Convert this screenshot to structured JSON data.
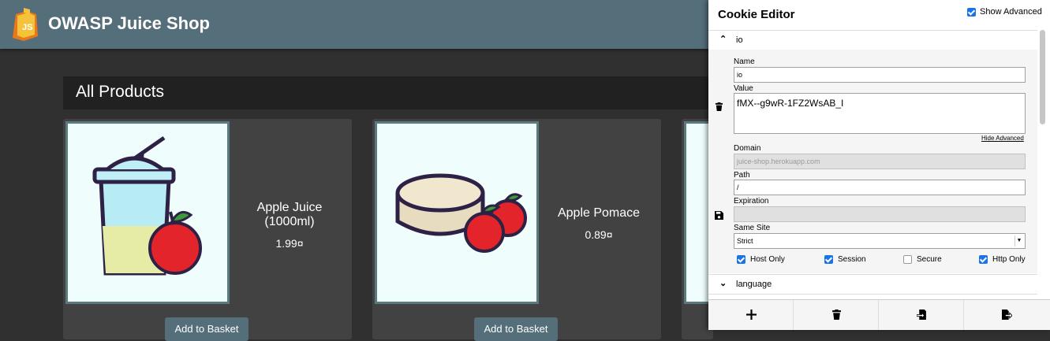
{
  "app": {
    "title": "OWASP Juice Shop"
  },
  "heading": "All Products",
  "products": [
    {
      "name": "Apple Juice (1000ml)",
      "price": "1.99¤",
      "button": "Add to Basket"
    },
    {
      "name": "Apple Pomace",
      "price": "0.89¤",
      "button": "Add to Basket"
    }
  ],
  "cookie_editor": {
    "title": "Cookie Editor",
    "show_advanced_label": "Show Advanced",
    "show_advanced_checked": true,
    "cookie_name": "io",
    "fields": {
      "name_label": "Name",
      "name_value": "io",
      "value_label": "Value",
      "value_value": "fMX--g9wR-1FZ2WsAB_I",
      "hide_advanced": "Hide Advanced",
      "domain_label": "Domain",
      "domain_value": "juice-shop.herokuapp.com",
      "path_label": "Path",
      "path_value": "/",
      "expiration_label": "Expiration",
      "expiration_value": "",
      "same_site_label": "Same Site",
      "same_site_value": "Strict"
    },
    "checkboxes": [
      {
        "label": "Host Only",
        "checked": true
      },
      {
        "label": "Session",
        "checked": true
      },
      {
        "label": "Secure",
        "checked": false
      },
      {
        "label": "Http Only",
        "checked": true
      }
    ],
    "next_cookie": "language",
    "footer_buttons": [
      "add-icon",
      "delete-all-icon",
      "import-icon",
      "export-icon"
    ]
  },
  "colors": {
    "toolbar": "#546e7a",
    "background": "#303030",
    "card": "#424242",
    "checkbox": "#1a73e8"
  }
}
